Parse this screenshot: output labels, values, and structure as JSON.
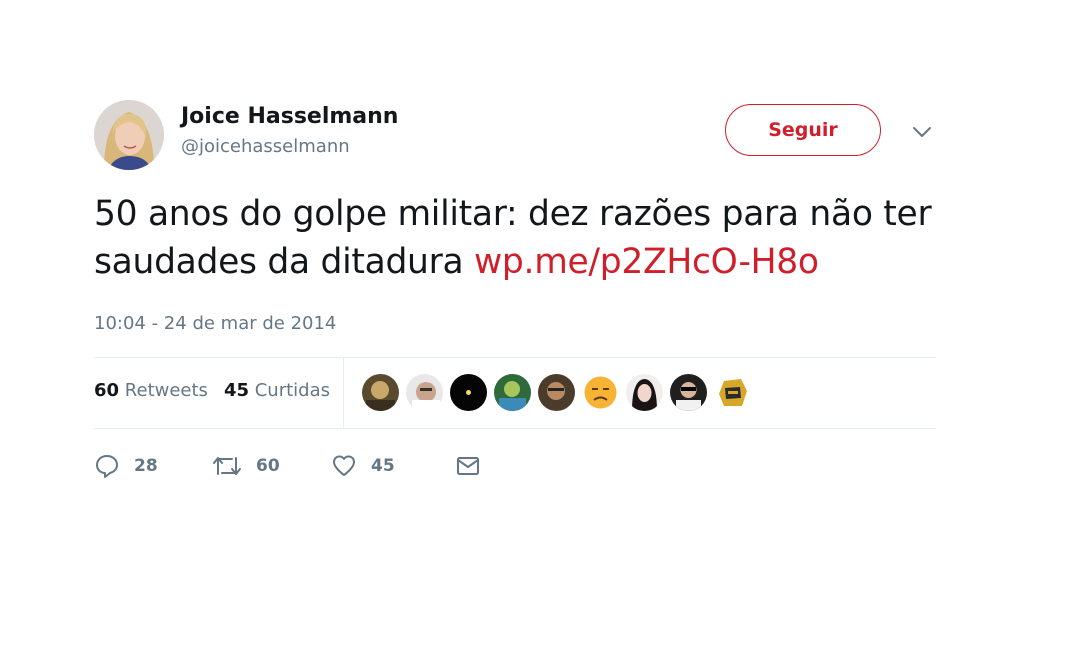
{
  "author": {
    "display_name": "Joice Hasselmann",
    "handle": "@joicehasselmann",
    "avatar_alt": "avatar"
  },
  "follow_label": "Seguir",
  "tweet": {
    "text": "50 anos do golpe militar: dez razões para não ter saudades da ditadura ",
    "link": "wp.me/p2ZHcO-H8o",
    "timestamp": "10:04 - 24 de mar de 2014"
  },
  "stats": {
    "retweets_count": "60",
    "retweets_label": "Retweets",
    "likes_count": "45",
    "likes_label": "Curtidas"
  },
  "actions": {
    "replies": "28",
    "retweets": "60",
    "likes": "45"
  },
  "colors": {
    "accent": "#d01f2a",
    "muted": "#657786",
    "text": "#14171a",
    "border": "#e6ecf0"
  },
  "icons": {
    "reply": "reply-icon",
    "retweet": "retweet-icon",
    "like": "heart-icon",
    "dm": "envelope-icon",
    "menu": "chevron-down-icon"
  }
}
